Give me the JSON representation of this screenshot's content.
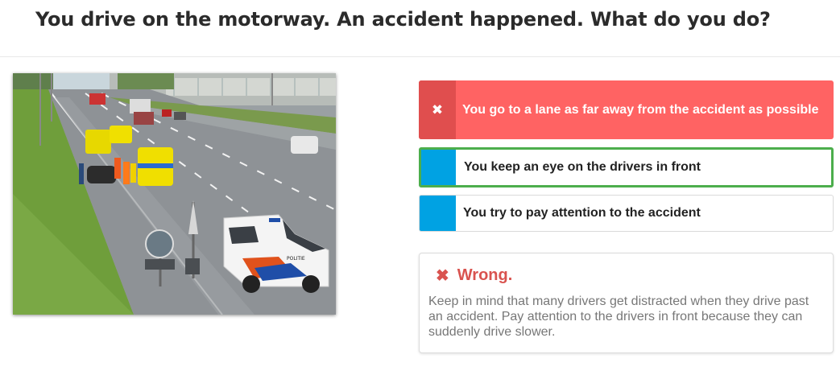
{
  "question": "You drive on the motorway. An accident happened. What do you do?",
  "image": {
    "description_icon": "motorway-accident-photo",
    "police_van_text": "POLITIE"
  },
  "answers": [
    {
      "label": "You go to a lane as far away from the accident as possible",
      "state": "wrong",
      "icon": "close-icon"
    },
    {
      "label": "You keep an eye on the drivers in front",
      "state": "correct"
    },
    {
      "label": "You try to pay attention to the accident",
      "state": "neutral"
    }
  ],
  "feedback": {
    "icon": "close-icon",
    "title": "Wrong.",
    "body": "Keep in mind that many drivers get distracted when they drive past an accident. Pay attention to the drivers in front because they can suddenly drive slower."
  },
  "colors": {
    "wrong_bg": "#ff6363",
    "wrong_mark": "#e04e4e",
    "correct_border": "#4cae4c",
    "accent_blue": "#00a2e3",
    "feedback_red": "#d9534f"
  }
}
